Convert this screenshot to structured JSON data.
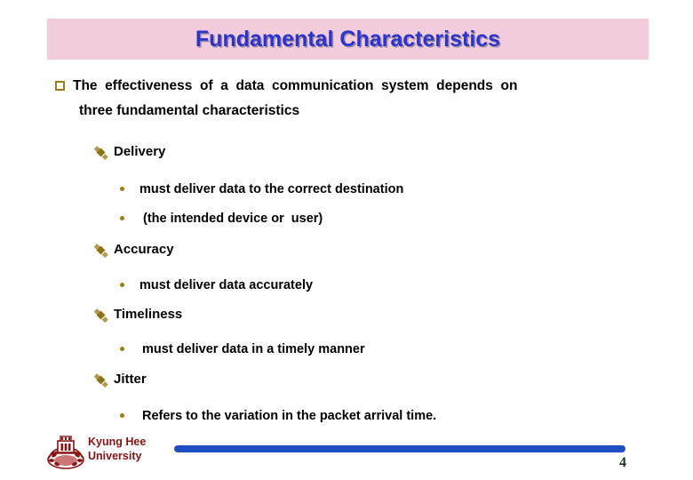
{
  "slide": {
    "title": "Fundamental Characteristics",
    "page_number": "4",
    "colors": {
      "banner_background": "#f2cbdd",
      "title_text": "#2b35cc",
      "bullet_marker": "#9a7d15",
      "footer_text": "#8c1212",
      "footer_bar": "#1f4fc4",
      "page_number": "#16371d"
    }
  },
  "content": {
    "intro": {
      "marker": "hollow-square-icon",
      "line1": "The  effectiveness  of  a  data  communication  system  depends  on",
      "line2": "three fundamental characteristics"
    },
    "sections": [
      {
        "marker": "diamond-flower-icon",
        "heading": "Delivery",
        "points": [
          {
            "marker": "dot-icon",
            "text": "must deliver data to the correct destination"
          },
          {
            "marker": "dot-icon",
            "text": " (the intended device or  user)"
          }
        ]
      },
      {
        "marker": "diamond-flower-icon",
        "heading": "Accuracy",
        "points": [
          {
            "marker": "dot-icon",
            "text": "must deliver data accurately"
          }
        ]
      },
      {
        "marker": "diamond-flower-icon",
        "heading": "Timeliness",
        "points": [
          {
            "marker": "dot-icon",
            "text": "must deliver data in a timely manner"
          }
        ]
      },
      {
        "marker": "diamond-flower-icon",
        "heading": "Jitter",
        "points": [
          {
            "marker": "dot-icon",
            "text": "Refers to the variation in the packet arrival time."
          }
        ]
      }
    ]
  },
  "footer": {
    "logo": "kyung-hee-university-crest-icon",
    "organization": "Kyung Hee\nUniversity"
  }
}
